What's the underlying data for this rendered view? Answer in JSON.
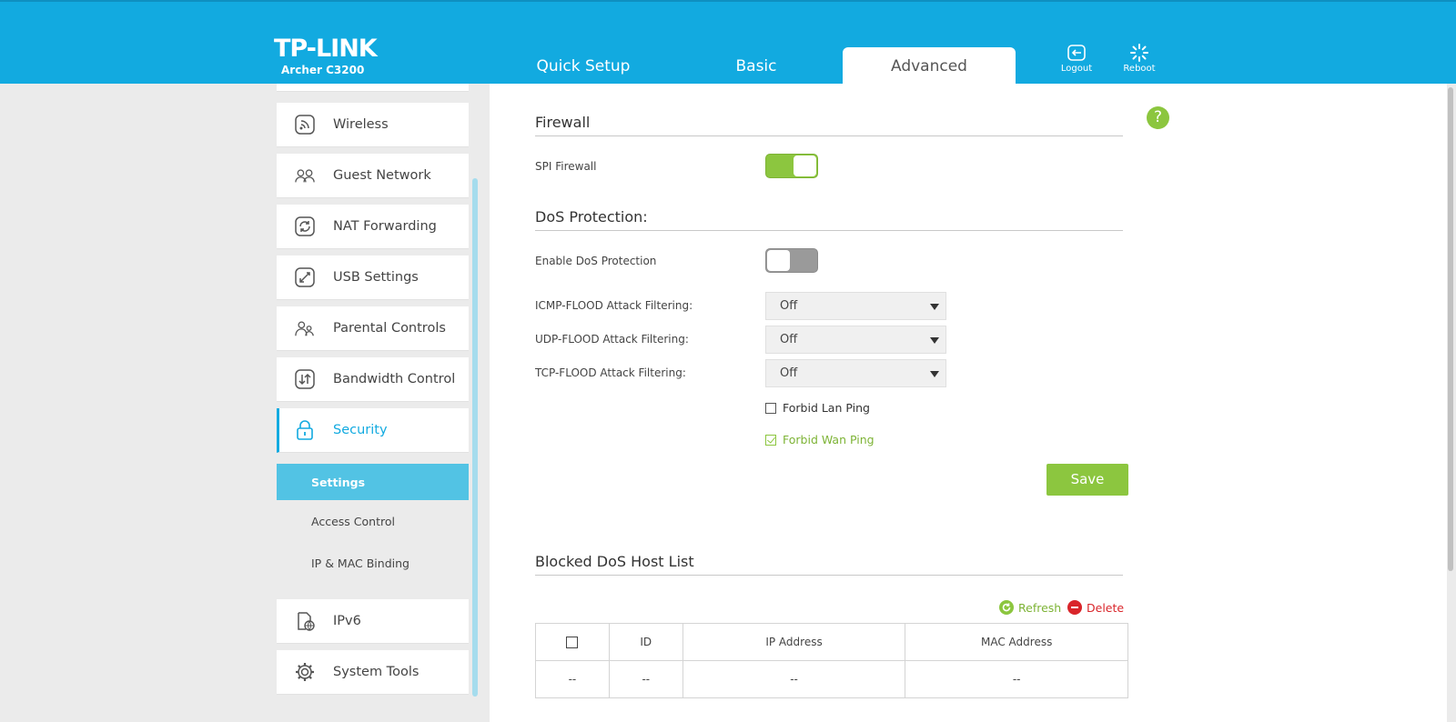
{
  "header": {
    "brand": "TP-LINK",
    "model": "Archer C3200",
    "tabs": [
      "Quick Setup",
      "Basic",
      "Advanced"
    ],
    "active_tab": "Advanced",
    "logout_label": "Logout",
    "reboot_label": "Reboot"
  },
  "sidebar": {
    "items": [
      {
        "label": "Wireless",
        "icon": "wireless-icon"
      },
      {
        "label": "Guest Network",
        "icon": "guest-network-icon"
      },
      {
        "label": "NAT Forwarding",
        "icon": "nat-forwarding-icon"
      },
      {
        "label": "USB Settings",
        "icon": "usb-icon"
      },
      {
        "label": "Parental Controls",
        "icon": "parental-controls-icon"
      },
      {
        "label": "Bandwidth Control",
        "icon": "bandwidth-icon"
      },
      {
        "label": "Security",
        "icon": "lock-icon"
      },
      {
        "label": "IPv6",
        "icon": "ipv6-icon"
      },
      {
        "label": "System Tools",
        "icon": "gear-icon"
      }
    ],
    "active_item": "Security",
    "subitems": [
      "Settings",
      "Access Control",
      "IP & MAC Binding"
    ],
    "active_subitem": "Settings"
  },
  "firewall": {
    "title": "Firewall",
    "spi_label": "SPI Firewall",
    "spi_enabled": true
  },
  "dos": {
    "title": "DoS Protection:",
    "enable_label": "Enable DoS Protection",
    "enabled": false,
    "icmp_label": "ICMP-FLOOD Attack Filtering:",
    "icmp_value": "Off",
    "udp_label": "UDP-FLOOD Attack Filtering:",
    "udp_value": "Off",
    "tcp_label": "TCP-FLOOD Attack Filtering:",
    "tcp_value": "Off",
    "forbid_lan_label": "Forbid Lan Ping",
    "forbid_lan_checked": false,
    "forbid_wan_label": "Forbid Wan Ping",
    "forbid_wan_checked": true,
    "save_label": "Save"
  },
  "blocked": {
    "title": "Blocked DoS Host List",
    "refresh_label": "Refresh",
    "delete_label": "Delete",
    "columns": [
      "ID",
      "IP Address",
      "MAC Address"
    ],
    "row": [
      "--",
      "--",
      "--",
      "--"
    ]
  },
  "help_label": "?",
  "colors": {
    "header_blue": "#12aae0",
    "accent_green": "#8cc63f",
    "delete_red": "#d9252a",
    "active_sub": "#52c3e4"
  }
}
